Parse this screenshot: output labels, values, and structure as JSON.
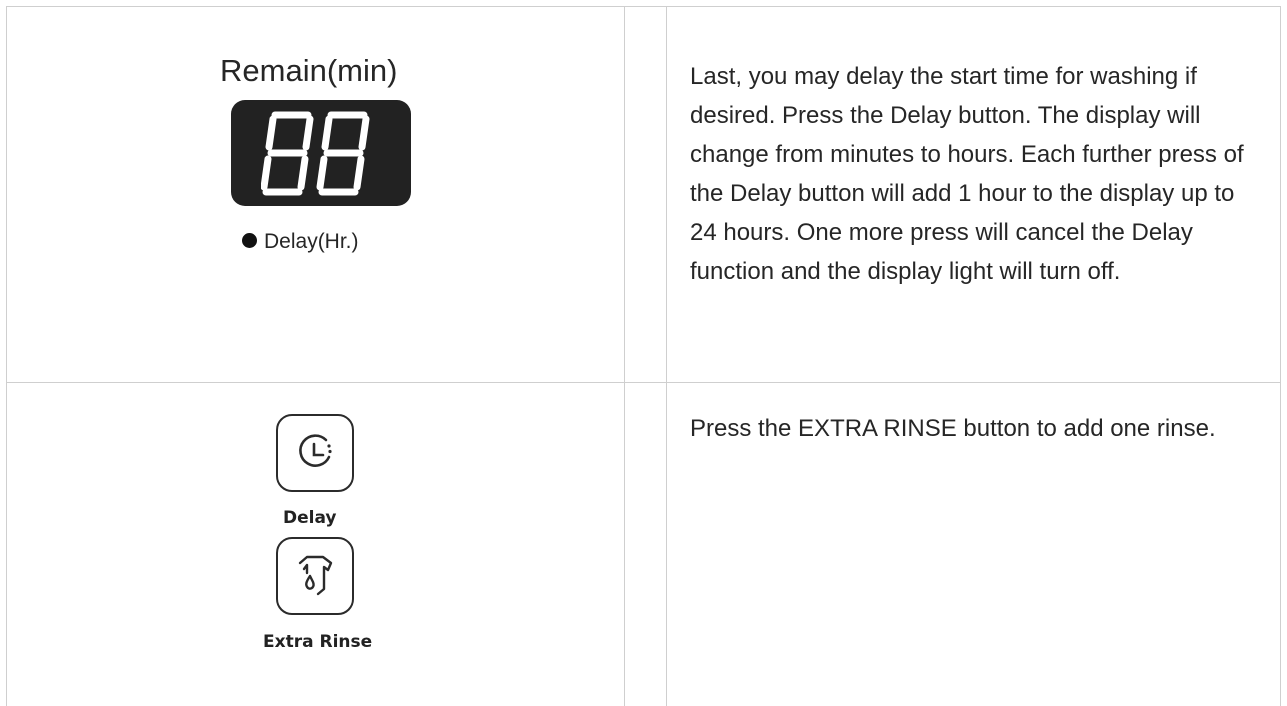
{
  "rows": [
    {
      "display": {
        "label": "Remain(min)",
        "digits": "88",
        "indicator_label": "Delay(Hr.)"
      },
      "text": "Last, you may delay the start time for washing if desired. Press the Delay button. The display will change from minutes to hours. Each further press of the Delay button will add 1 hour to the display up to 24 hours. One more press will cancel the Delay function and the display light will turn off."
    },
    {
      "buttons": [
        {
          "label": "Delay",
          "icon": "clock-icon"
        },
        {
          "label": "Extra Rinse",
          "icon": "extra-rinse-icon"
        }
      ],
      "text": "Press the EXTRA RINSE button to add one rinse."
    }
  ],
  "colors": {
    "border": "#cfcfcf",
    "text": "#262626",
    "display_bg": "#222222",
    "segment": "#ffffff"
  }
}
